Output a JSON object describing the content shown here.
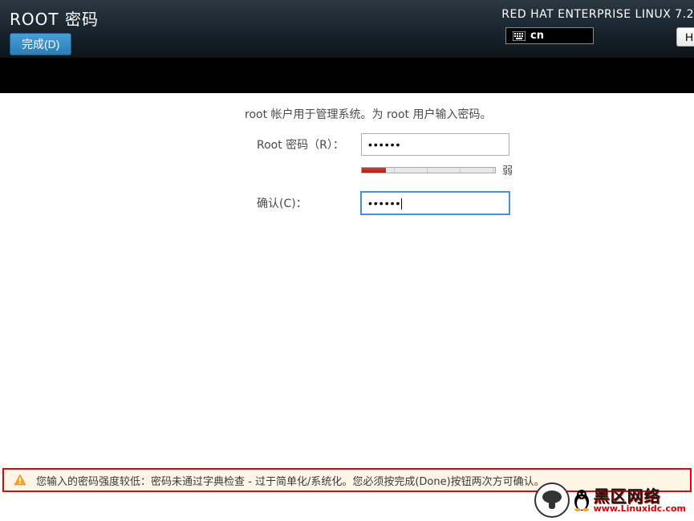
{
  "header": {
    "title": "ROOT 密码",
    "done_button": "完成(D)",
    "os_info": "RED HAT ENTERPRISE LINUX 7.2",
    "keyboard_layout": "cn",
    "help_button": "H"
  },
  "form": {
    "intro_text": "root 帐户用于管理系统。为 root 用户输入密码。",
    "password_label": "Root 密码（R）：",
    "password_value": "••••••",
    "confirm_label": "确认(C)：",
    "confirm_value": "••••••",
    "strength_label": "弱",
    "strength_percent": 18
  },
  "warning": {
    "message": "您输入的密码强度较低：密码未通过字典检查 - 过于简单化/系统化。您必须按完成(Done)按钮两次方可确认。"
  },
  "watermark": {
    "site_name": "黑区网络",
    "site_url": "www.Linuxidc.com"
  }
}
